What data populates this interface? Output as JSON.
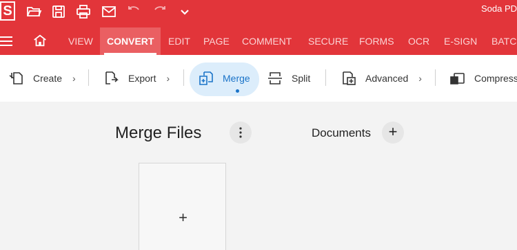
{
  "titlebar": {
    "logo_letter": "S",
    "title": "Soda PDF"
  },
  "menubar": {
    "items": [
      "VIEW",
      "CONVERT",
      "EDIT",
      "PAGE",
      "COMMENT",
      "SECURE",
      "FORMS",
      "OCR",
      "E-SIGN",
      "BATCH"
    ],
    "active": "CONVERT"
  },
  "ribbon": {
    "items": [
      {
        "label": "Create",
        "icon": "create-icon",
        "chevron": "›"
      },
      {
        "label": "Export",
        "icon": "export-icon",
        "chevron": "›"
      },
      {
        "label": "Merge",
        "icon": "merge-icon",
        "chevron": ""
      },
      {
        "label": "Split",
        "icon": "split-icon",
        "chevron": ""
      },
      {
        "label": "Advanced",
        "icon": "advanced-icon",
        "chevron": "›"
      },
      {
        "label": "Compress",
        "icon": "compress-icon",
        "chevron": ""
      }
    ],
    "active": "Merge"
  },
  "main": {
    "title": "Merge Files",
    "kebab": "⋮",
    "documents_label": "Documents",
    "add_symbol": "+",
    "drop_symbol": "+"
  },
  "colors": {
    "brand_red": "#e2353a",
    "active_tab": "#ea5f62",
    "active_ribbon_bg": "#dcedfb",
    "accent_blue": "#1a73c8"
  }
}
